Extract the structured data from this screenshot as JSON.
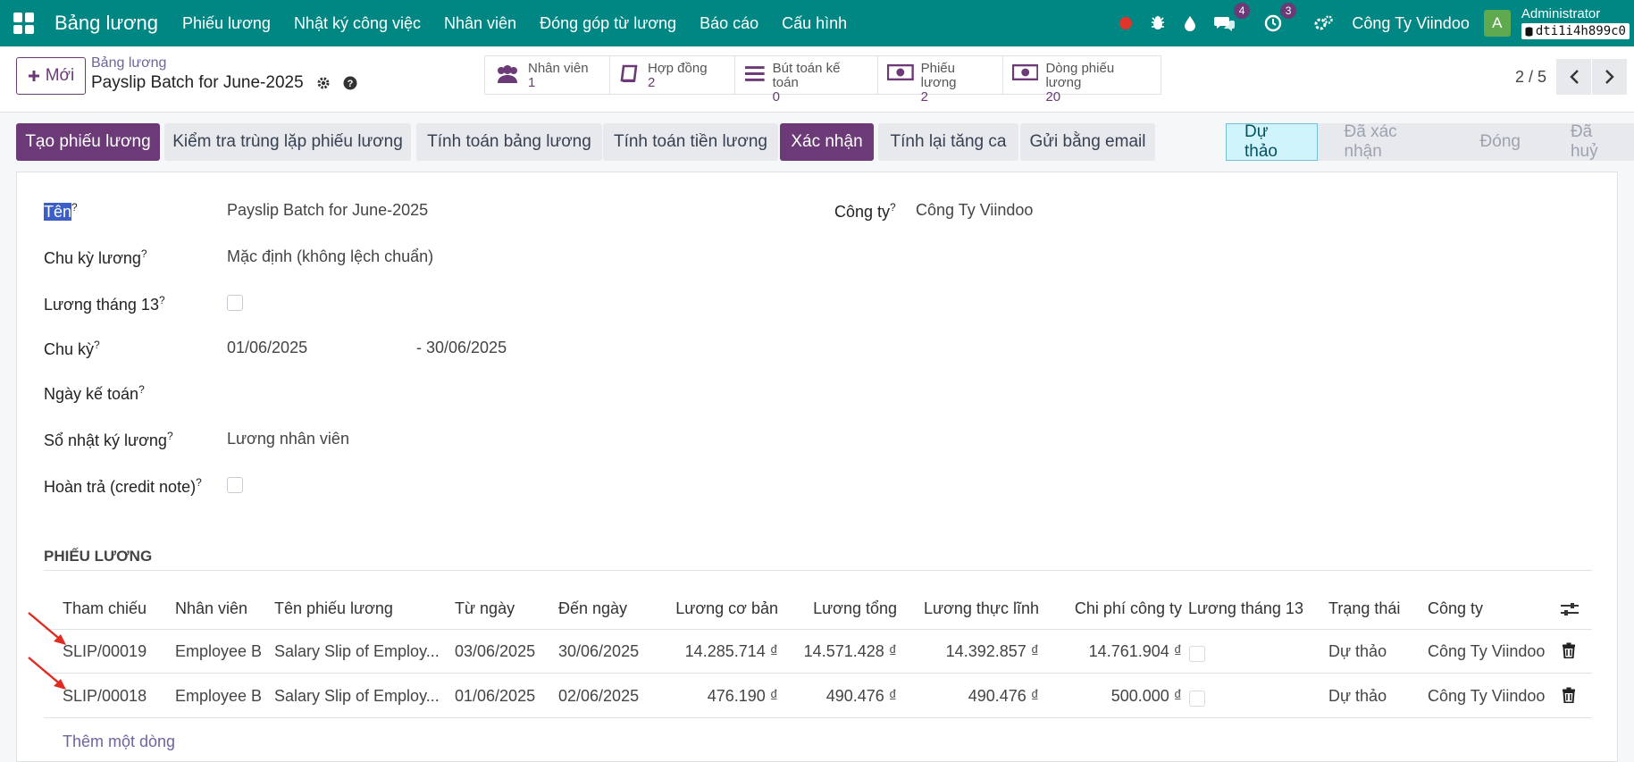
{
  "navbar": {
    "app_name": "Bảng lương",
    "menu": [
      "Phiếu lương",
      "Nhật ký công việc",
      "Nhân viên",
      "Đóng góp từ lương",
      "Báo cáo",
      "Cấu hình"
    ],
    "messages_count": "4",
    "activities_count": "3",
    "company": "Công Ty Viindoo",
    "avatar_letter": "A",
    "user_name": "Administrator",
    "db_name": "dti1i4h899c0"
  },
  "control": {
    "new_label": "Mới",
    "breadcrumb": "Bảng lương",
    "title": "Payslip Batch for June-2025",
    "stats": [
      {
        "label": "Nhân viên",
        "value": "1",
        "icon": "users-icon"
      },
      {
        "label": "Hợp đồng",
        "value": "2",
        "icon": "book-icon"
      },
      {
        "label": "Bút toán kế toán",
        "value": "0",
        "icon": "list-icon"
      },
      {
        "label": "Phiếu lương",
        "value": "2",
        "icon": "money-icon"
      },
      {
        "label": "Dòng phiếu lương",
        "value": "20",
        "icon": "money-icon"
      }
    ],
    "pager": "2 / 5"
  },
  "actions": {
    "create_payslips": "Tạo phiếu lương",
    "check_duplicate": "Kiểm tra trùng lặp phiếu lương",
    "compute_sheet": "Tính toán bảng lương",
    "compute_salary": "Tính toán tiền lương",
    "confirm": "Xác nhận",
    "recompute_overtime": "Tính lại tăng ca",
    "send_email": "Gửi bằng email"
  },
  "status": {
    "stages": [
      "Dự thảo",
      "Đã xác nhận",
      "Đóng",
      "Đã huỷ"
    ],
    "active": "Dự thảo"
  },
  "form": {
    "name_label": "Tên",
    "name_value": "Payslip Batch for June-2025",
    "company_label": "Công ty",
    "company_value": "Công Ty Viindoo",
    "salary_cycle_label": "Chu kỳ lương",
    "salary_cycle_value": "Mặc định (không lệch chuẩn)",
    "thirteen_month_label": "Lương tháng 13",
    "period_label": "Chu kỳ",
    "period_from": "01/06/2025",
    "period_to": "- 30/06/2025",
    "accounting_date_label": "Ngày kế toán",
    "journal_label": "Sổ nhật ký lương",
    "journal_value": "Lương nhân viên",
    "credit_note_label": "Hoàn trả (credit note)",
    "help_mark": "?"
  },
  "table": {
    "section_title": "PHIẾU LƯƠNG",
    "columns": [
      "Tham chiếu",
      "Nhân viên",
      "Tên phiếu lương",
      "Từ ngày",
      "Đến ngày",
      "Lương cơ bản",
      "Lương tổng",
      "Lương thực lĩnh",
      "Chi phí công ty",
      "Lương tháng 13",
      "Trạng thái",
      "Công ty"
    ],
    "rows": [
      [
        "SLIP/00019",
        "Employee B",
        "Salary Slip of Employ...",
        "03/06/2025",
        "30/06/2025",
        "14.285.714 ₫",
        "14.571.428 ₫",
        "14.392.857 ₫",
        "14.761.904 ₫",
        "",
        "Dự thảo",
        "Công Ty Viindoo"
      ],
      [
        "SLIP/00018",
        "Employee B",
        "Salary Slip of Employ...",
        "01/06/2025",
        "02/06/2025",
        "476.190 ₫",
        "490.476 ₫",
        "490.476 ₫",
        "500.000 ₫",
        "",
        "Dự thảo",
        "Công Ty Viindoo"
      ]
    ],
    "add_line": "Thêm một dòng"
  }
}
